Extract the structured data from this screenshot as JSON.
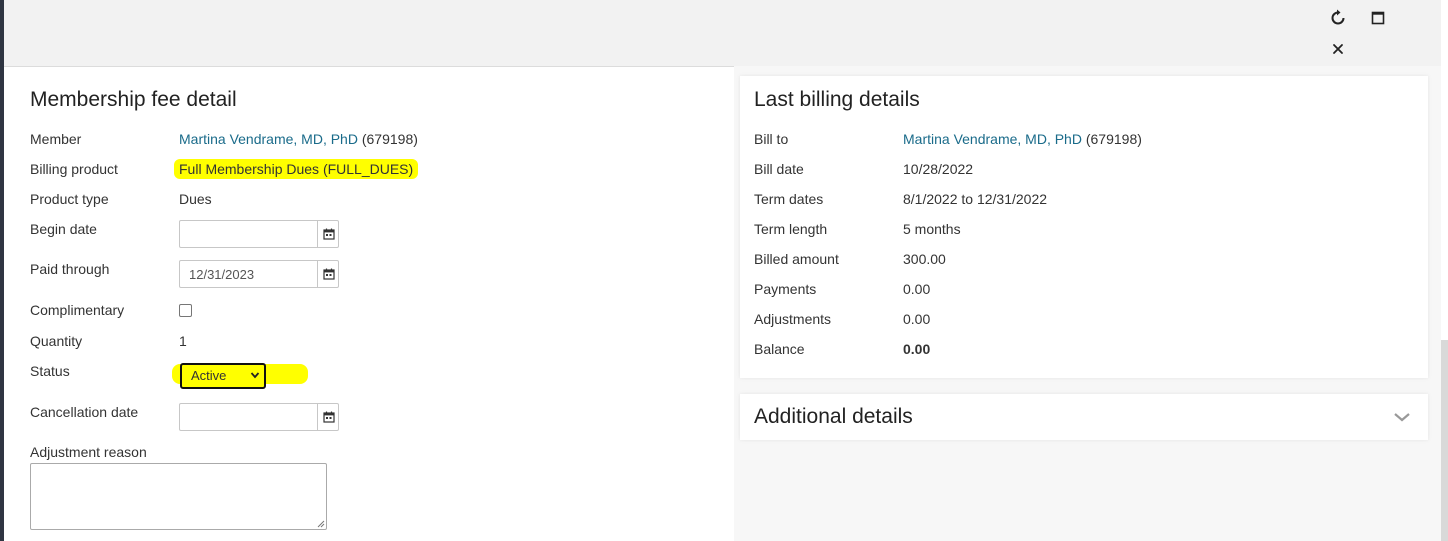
{
  "window": {
    "refresh_icon": "refresh-icon",
    "maximize_icon": "maximize-icon",
    "close_icon": "close-icon"
  },
  "fee_detail": {
    "title": "Membership fee detail",
    "member_label": "Member",
    "member_name": "Martina Vendrame, MD, PhD",
    "member_id": "(679198)",
    "billing_product_label": "Billing product",
    "billing_product_value": "Full Membership Dues (FULL_DUES)",
    "product_type_label": "Product type",
    "product_type_value": "Dues",
    "begin_date_label": "Begin date",
    "begin_date_value": "",
    "paid_through_label": "Paid through",
    "paid_through_value": "12/31/2023",
    "complimentary_label": "Complimentary",
    "complimentary_checked": false,
    "quantity_label": "Quantity",
    "quantity_value": "1",
    "status_label": "Status",
    "status_value": "Active",
    "cancellation_date_label": "Cancellation date",
    "cancellation_date_value": "",
    "adjustment_reason_label": "Adjustment reason",
    "adjustment_reason_value": ""
  },
  "billing": {
    "title": "Last billing details",
    "bill_to_label": "Bill to",
    "bill_to_name": "Martina Vendrame, MD, PhD",
    "bill_to_id": "(679198)",
    "bill_date_label": "Bill date",
    "bill_date_value": "10/28/2022",
    "term_dates_label": "Term dates",
    "term_dates_value": "8/1/2022 to 12/31/2022",
    "term_length_label": "Term length",
    "term_length_value": "5 months",
    "billed_amount_label": "Billed amount",
    "billed_amount_value": "300.00",
    "payments_label": "Payments",
    "payments_value": "0.00",
    "adjustments_label": "Adjustments",
    "adjustments_value": "0.00",
    "balance_label": "Balance",
    "balance_value": "0.00"
  },
  "additional": {
    "title": "Additional details"
  },
  "colors": {
    "link": "#1a6b8a",
    "highlight": "#ffff00",
    "titlebar": "#f2f2f2"
  }
}
